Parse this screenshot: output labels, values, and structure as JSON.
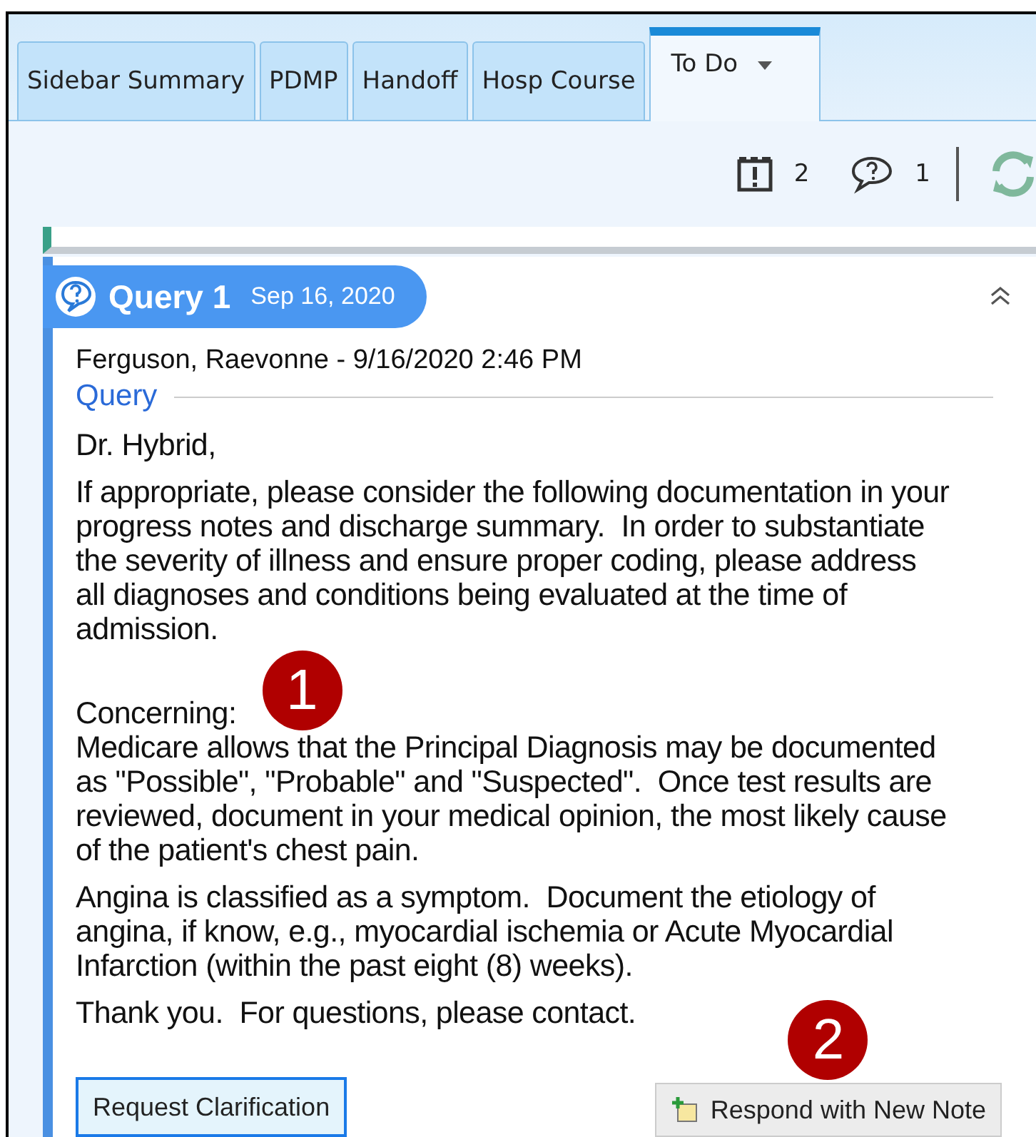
{
  "tabs": [
    {
      "label": "Sidebar Summary",
      "selected": false,
      "dropdown": false
    },
    {
      "label": "PDMP",
      "selected": false,
      "dropdown": false
    },
    {
      "label": "Handoff",
      "selected": false,
      "dropdown": false
    },
    {
      "label": "Hosp Course",
      "selected": false,
      "dropdown": false
    },
    {
      "label": "To Do",
      "selected": true,
      "dropdown": true
    }
  ],
  "toolbar": {
    "alerts_count": "2",
    "queries_count": "1"
  },
  "query": {
    "title": "Query 1",
    "date": "Sep 16, 2020",
    "author_line": "Ferguson, Raevonne - 9/16/2020 2:46 PM",
    "section": "Query",
    "paragraphs": [
      {
        "lines": [
          "Dr. Hybrid,"
        ]
      },
      {
        "lines": [
          "If appropriate, please consider the following documentation in your",
          "progress notes and discharge summary.  In order to substantiate",
          "the severity of illness and ensure proper coding, please address",
          "all diagnoses and conditions being evaluated at the time of",
          "admission."
        ]
      },
      {
        "lines": [
          "Concerning:",
          "Medicare allows that the Principal Diagnosis may be documented",
          "as \"Possible\", \"Probable\" and \"Suspected\".  Once test results are",
          "reviewed, document in your medical opinion, the most likely cause",
          "of the patient's chest pain."
        ]
      },
      {
        "lines": [
          "Angina is classified as a symptom.  Document the etiology of",
          "angina, if know, e.g., myocardial ischemia or Acute Myocardial",
          "Infarction (within the past eight (8) weeks)."
        ]
      },
      {
        "lines": [
          "Thank you.  For questions, please contact."
        ]
      }
    ],
    "buttons": [
      {
        "label": "Request Clarification",
        "kind": "focused"
      },
      {
        "label": "Respond with New Note",
        "kind": "icon"
      }
    ]
  },
  "callouts": [
    "1",
    "2"
  ]
}
